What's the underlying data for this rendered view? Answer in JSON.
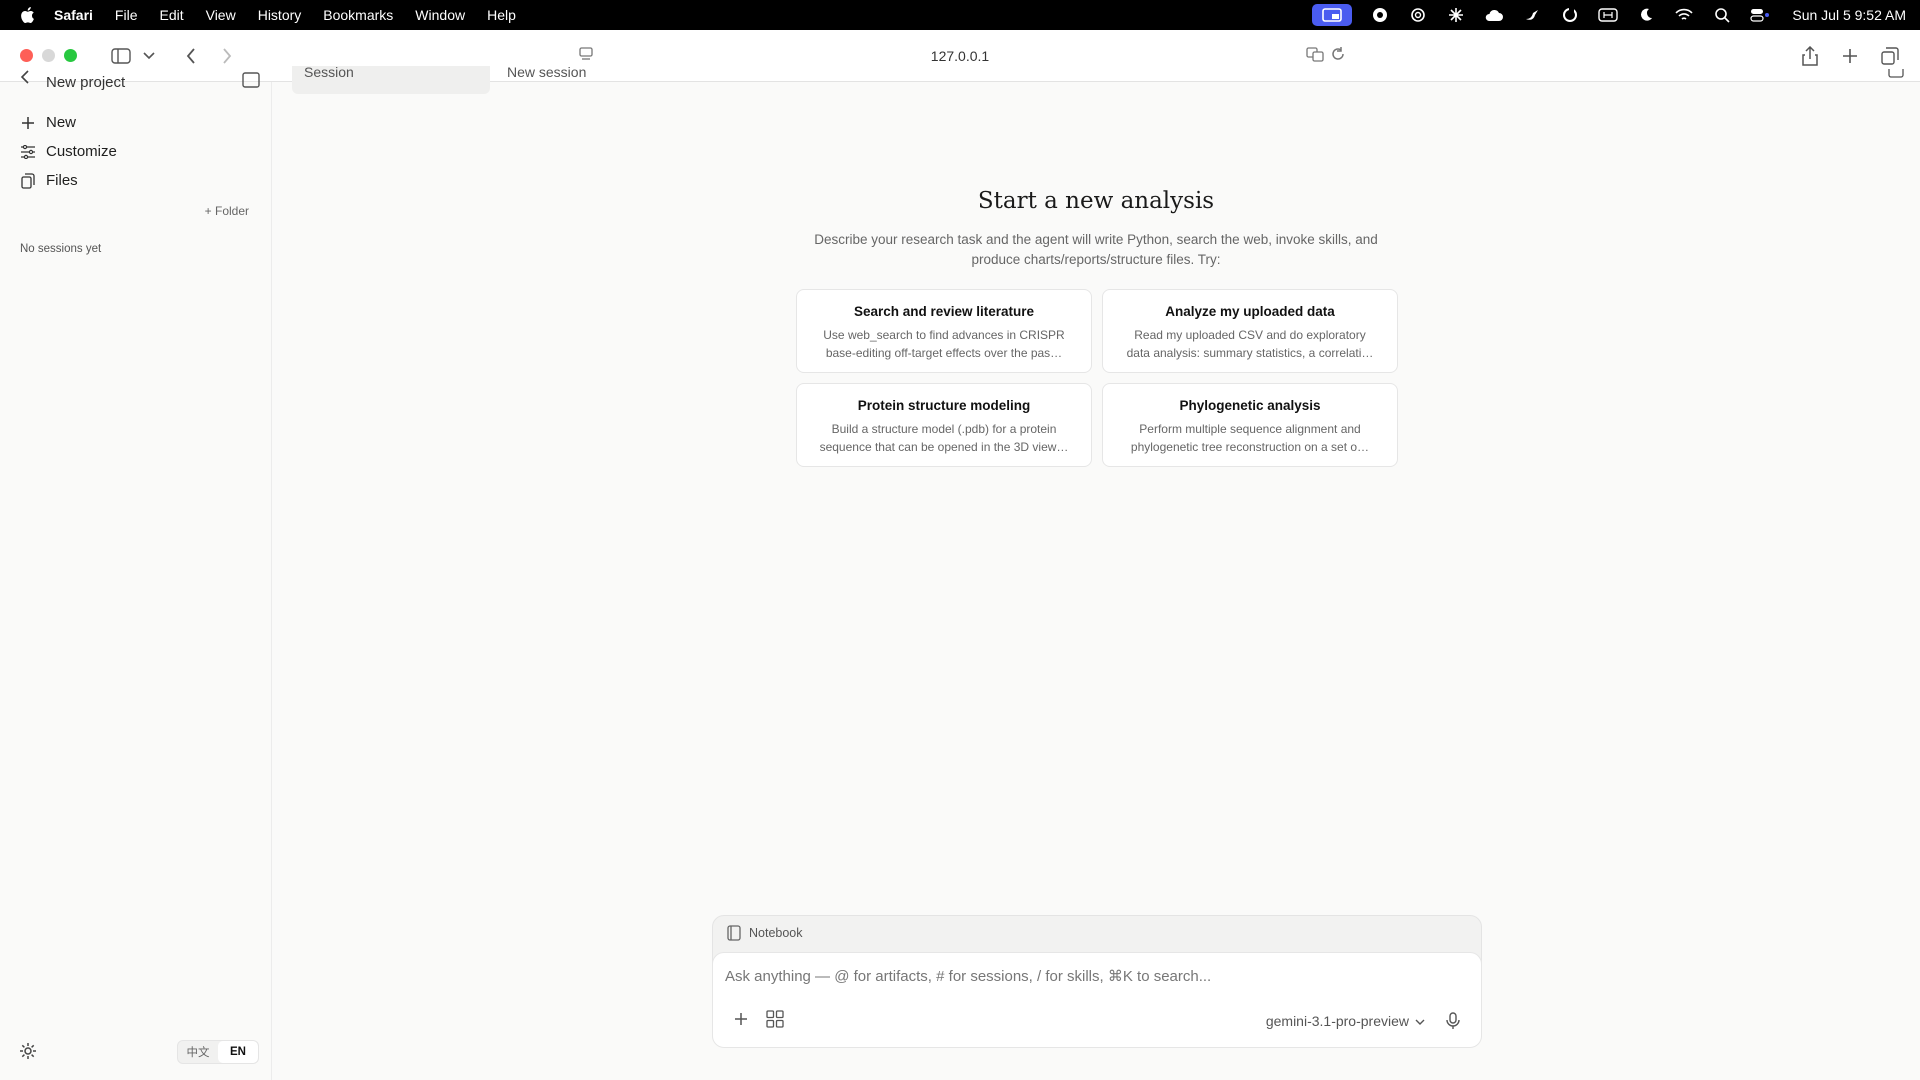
{
  "menubar": {
    "app": "Safari",
    "items": [
      "File",
      "Edit",
      "View",
      "History",
      "Bookmarks",
      "Window",
      "Help"
    ],
    "clock": "Sun Jul 5  9:52 AM",
    "status_icons": [
      "screen-share-icon",
      "chat-icon",
      "openai-icon",
      "sparkle-icon",
      "cloud-icon",
      "bird-icon",
      "sync-icon",
      "input-method-icon",
      "moon-icon",
      "wifi-icon",
      "search-icon",
      "control-center-icon"
    ]
  },
  "browser": {
    "address": "127.0.0.1"
  },
  "sidebar": {
    "project_title": "New project",
    "nav": [
      {
        "label": "New",
        "icon": "plus-icon"
      },
      {
        "label": "Customize",
        "icon": "sliders-icon"
      },
      {
        "label": "Files",
        "icon": "files-icon"
      }
    ],
    "folder_button": "+ Folder",
    "empty_state": "No sessions yet",
    "lang": {
      "zh": "中文",
      "en": "EN"
    }
  },
  "tabs": {
    "session": "Session",
    "new_session": "New session"
  },
  "hero": {
    "title": "Start a new analysis",
    "description": "Describe your research task and the agent will write Python, search the web, invoke skills, and produce charts/reports/structure files. Try:"
  },
  "cards": [
    {
      "title": "Search and review literature",
      "desc": "Use web_search to find advances in CRISPR base-editing off-target effects over the pas…"
    },
    {
      "title": "Analyze my uploaded data",
      "desc": "Read my uploaded CSV and do exploratory data analysis: summary statistics, a correlati…"
    },
    {
      "title": "Protein structure modeling",
      "desc": "Build a structure model (.pdb) for a protein sequence that can be opened in the 3D view…"
    },
    {
      "title": "Phylogenetic analysis",
      "desc": "Perform multiple sequence alignment and phylogenetic tree reconstruction on a set o…"
    }
  ],
  "composer": {
    "notebook_label": "Notebook",
    "placeholder": "Ask anything — @ for artifacts, # for sessions, / for skills, ⌘K to search...",
    "model": "gemini-3.1-pro-preview"
  }
}
